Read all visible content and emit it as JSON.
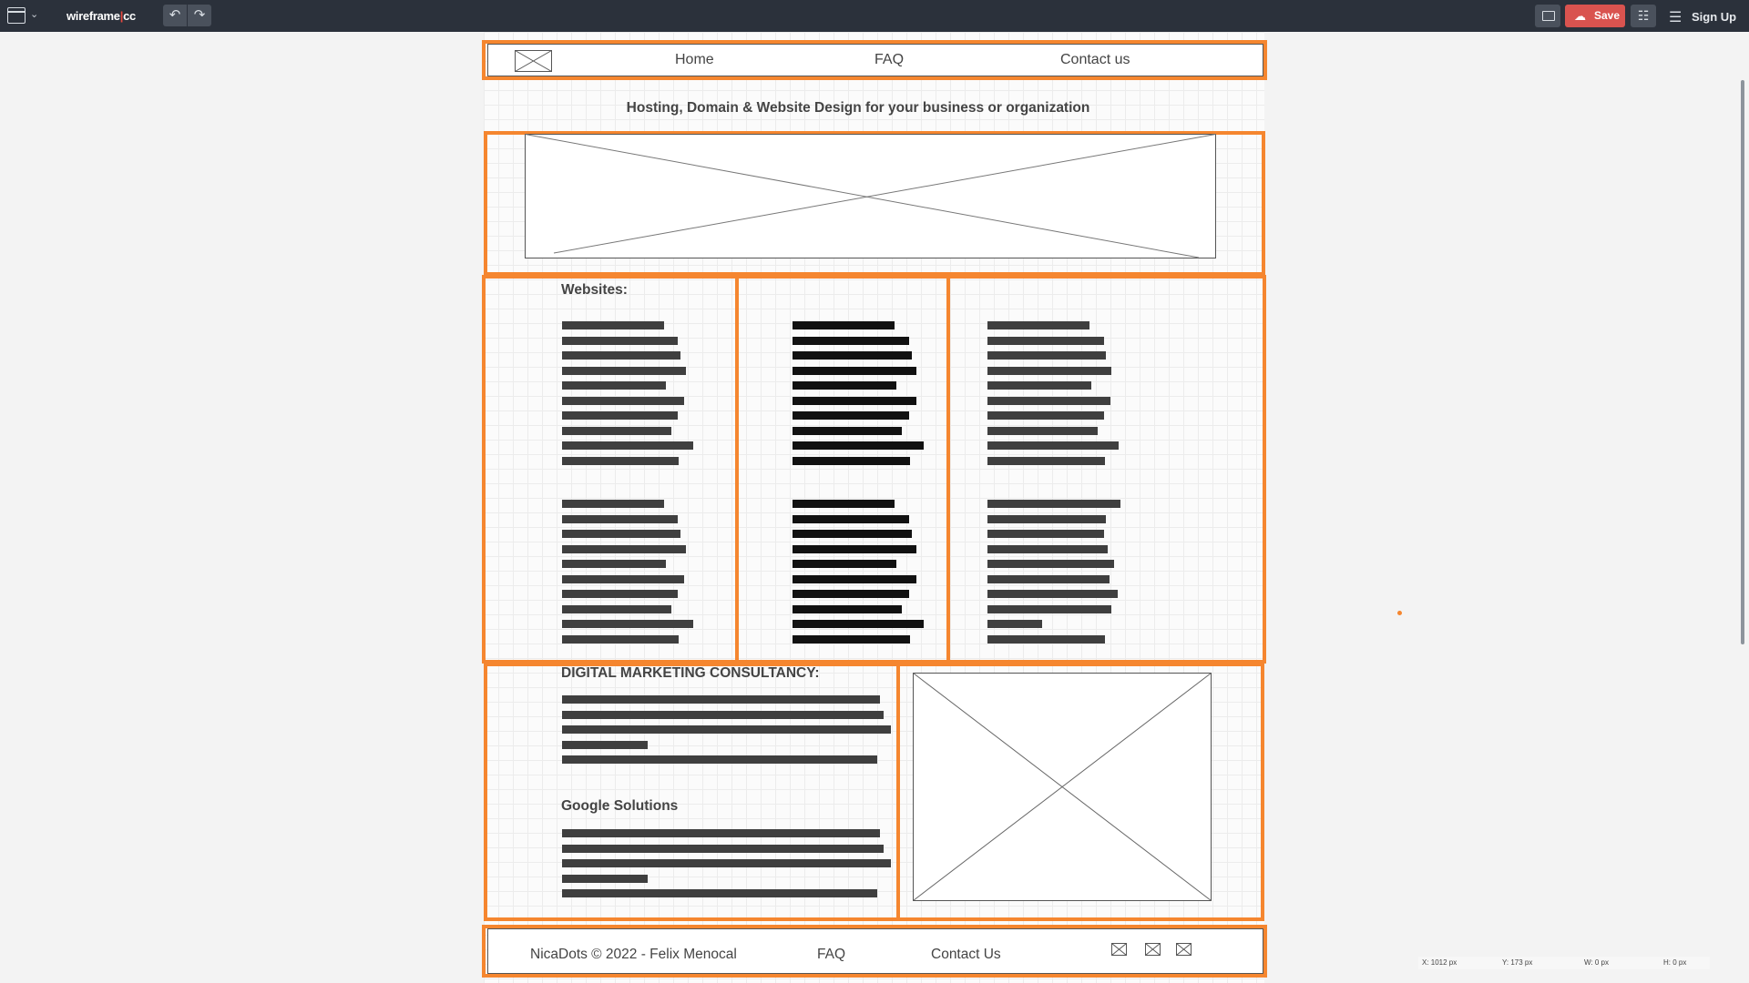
{
  "app": {
    "logo_main": "wireframe",
    "logo_sep": "|",
    "logo_tld": "cc",
    "undo_icon": "undo-icon",
    "redo_icon": "redo-icon",
    "save_label": "Save",
    "signup_label": "Sign Up"
  },
  "wireframe": {
    "nav": [
      "Home",
      "FAQ",
      "Contact us"
    ],
    "tagline": "Hosting, Domain & Website Design for your business or organization",
    "col1_heading": "Websites:",
    "marketing_heading": "DIGITAL MARKETING CONSULTANCY:",
    "google_heading": "Google Solutions",
    "footer": {
      "copyright": "NicaDots © 2022 - Felix Menocal",
      "faq": "FAQ",
      "contact": "Contact Us"
    },
    "accent_color": "#f5862f",
    "text_line_color": "#3f3f3f",
    "dark_text_line_color": "#111111"
  },
  "status": {
    "x": "X: 1012 px",
    "y": "Y: 173 px",
    "w": "W: 0 px",
    "h": "H: 0 px"
  }
}
